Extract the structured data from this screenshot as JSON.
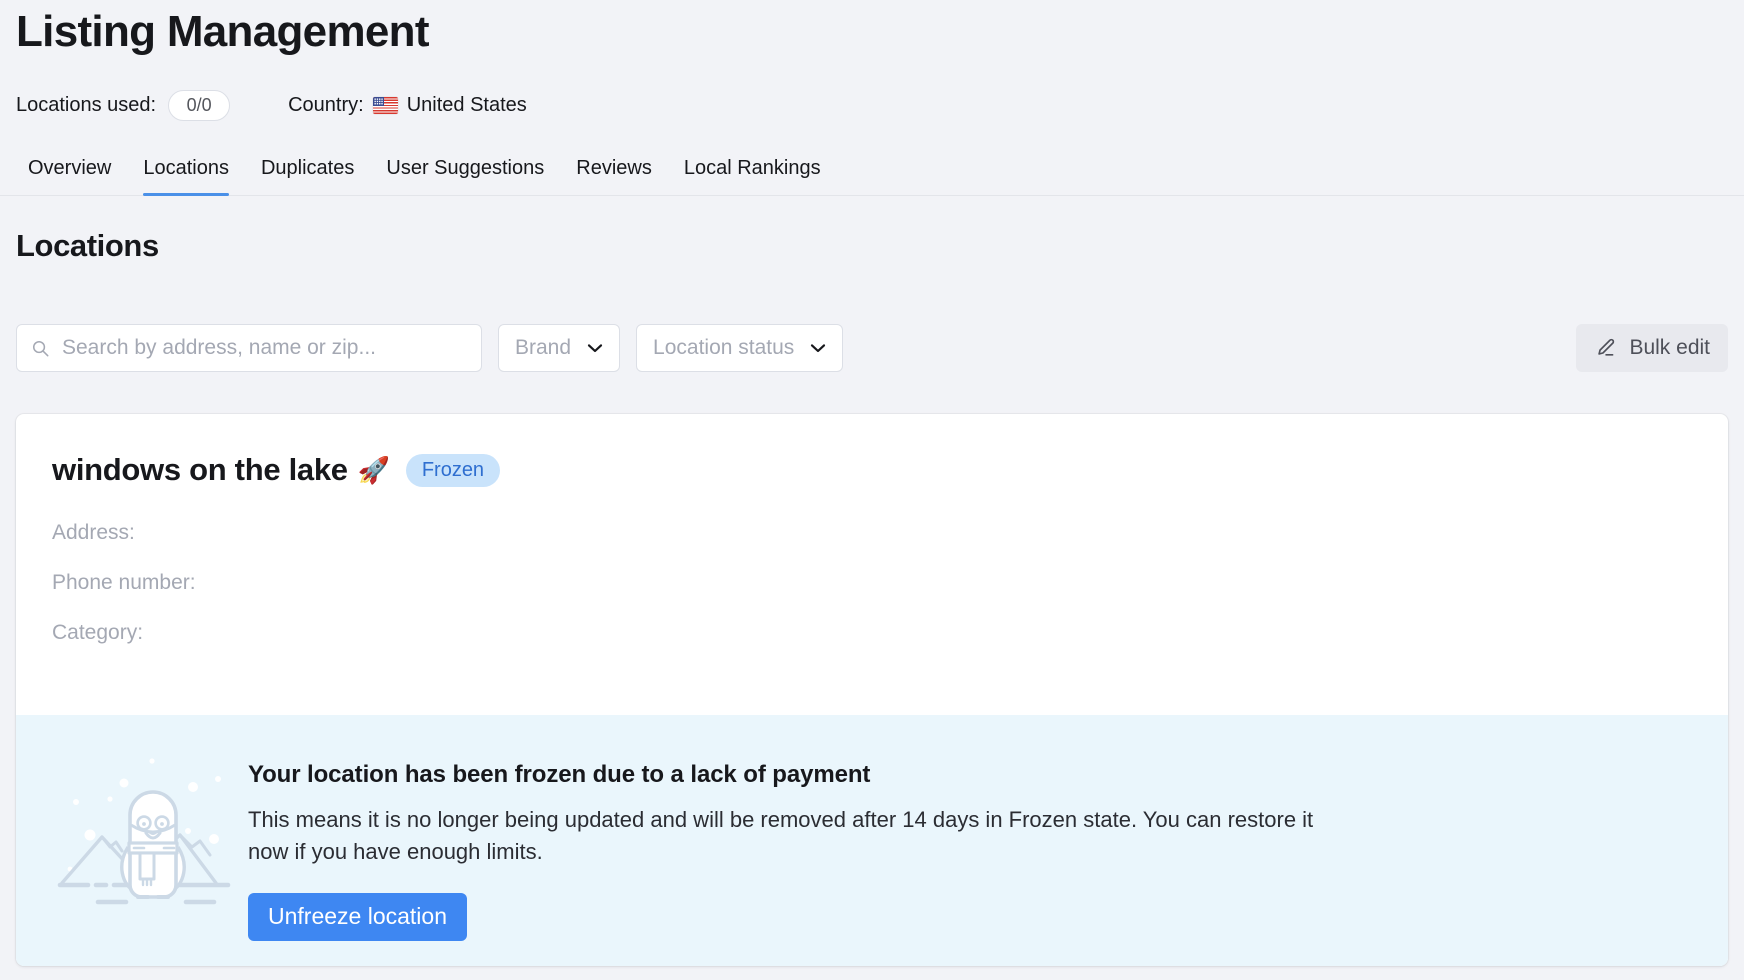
{
  "header": {
    "title": "Listing Management",
    "locations_used_label": "Locations used:",
    "locations_used_value": "0/0",
    "country_label": "Country:",
    "country_value": "United States",
    "flag_icon": "us-flag-icon"
  },
  "tabs": [
    {
      "label": "Overview",
      "active": false
    },
    {
      "label": "Locations",
      "active": true
    },
    {
      "label": "Duplicates",
      "active": false
    },
    {
      "label": "User Suggestions",
      "active": false
    },
    {
      "label": "Reviews",
      "active": false
    },
    {
      "label": "Local Rankings",
      "active": false
    }
  ],
  "section": {
    "title": "Locations"
  },
  "filters": {
    "search": {
      "placeholder": "Search by address, name or zip...",
      "value": "",
      "icon": "search-icon"
    },
    "brand": {
      "label": "Brand",
      "icon": "chevron-down-icon"
    },
    "location_status": {
      "label": "Location status",
      "icon": "chevron-down-icon"
    },
    "bulk_edit": {
      "label": "Bulk edit",
      "icon": "pencil-icon"
    }
  },
  "location_card": {
    "name": "windows on the lake",
    "emoji": "🚀",
    "status_badge": "Frozen",
    "details": [
      {
        "label": "Address:",
        "value": ""
      },
      {
        "label": "Phone number:",
        "value": ""
      },
      {
        "label": "Category:",
        "value": ""
      }
    ],
    "banner": {
      "illustration": "frozen-penguin-illustration",
      "title": "Your location has been frozen due to a lack of payment",
      "description": "This means it is no longer being updated and will be removed after 14 days in Frozen state. You can restore it now if you have enough limits.",
      "action_label": "Unfreeze location"
    }
  },
  "colors": {
    "page_bg": "#f2f3f7",
    "accent_blue": "#3e87f2",
    "tab_underline": "#4a90e8",
    "badge_bg": "#c9e3fb",
    "badge_text": "#2f6fd0",
    "banner_bg": "#eaf6fc",
    "illustration_line": "#ccd9e6"
  }
}
